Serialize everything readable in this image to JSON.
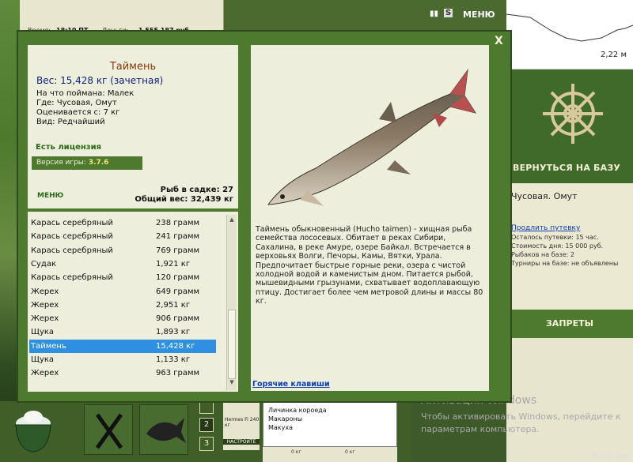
{
  "topbar": {
    "time_label": "Время:",
    "time_value": "18:10 ПТ",
    "money_label": "Деньги:",
    "money_value": "1 555 187 руб",
    "menu_label": "МЕНЮ"
  },
  "depth_chart": {
    "depth": "2,22 м"
  },
  "right_sidebar": {
    "return_label": "ВЕРНУТЬСЯ НА БАЗУ",
    "location": "Чусовая. Омут",
    "extend_link": "Продлить путевку",
    "lines": [
      "Осталось путевки: 15 час.",
      "Стоимость дня: 15 000 руб.",
      "Рыбаков на базе: 2",
      "Турниры на базе: не объявлены"
    ],
    "bans_label": "ЗАПРЕТЫ"
  },
  "fish_info": {
    "name": "Таймень",
    "weight": "Вес: 15,428 кг (зачетная)",
    "caught_on": "На что поймана: Малек",
    "where": "Где: Чусовая, Омут",
    "valued": "Оценивается с: 7 кг",
    "kind": "Вид: Редчайший",
    "license": "Есть лицензия",
    "version_label": "Версия игры:",
    "version_value": "3.7.6",
    "menu": "МЕНЮ",
    "keep_count": "Рыб в садке: 27",
    "keep_weight": "Общий вес: 32,439 кг"
  },
  "catch_list": [
    {
      "name": "Карась серебряный",
      "weight": "238 грамм"
    },
    {
      "name": "Карась серебряный",
      "weight": "241 грамм"
    },
    {
      "name": "Карась серебряный",
      "weight": "769 грамм"
    },
    {
      "name": "Судак",
      "weight": "1,921 кг"
    },
    {
      "name": "Карась серебряный",
      "weight": "120 грамм"
    },
    {
      "name": "Жерех",
      "weight": "649 грамм"
    },
    {
      "name": "Жерех",
      "weight": "2,951 кг"
    },
    {
      "name": "Жерех",
      "weight": "906 грамм"
    },
    {
      "name": "Щука",
      "weight": "1,893 кг"
    },
    {
      "name": "Таймень",
      "weight": "15,428 кг",
      "selected": true
    },
    {
      "name": "Щука",
      "weight": "1,133 кг"
    },
    {
      "name": "Жерех",
      "weight": "963 грамм"
    }
  ],
  "description": "Таймень обыкновенный (Hucho taimen) - хищная рыба семейства лососевых. Обитает в реках Сибири, Сахалина, в реке Амуре, озере Байкал. Встречается в верховьях Волги, Печоры, Камы, Вятки, Урала. Предпочитает быстрые горные реки, озера с чистой холодной водой и каменистым дном. Питается рыбой, мышевидными грызунами, схватывает водоплавающую птицу. Достигает более чем метровой длины и массы 80 кг.",
  "hotkeys": "Горячие клавиши",
  "close": "X",
  "bottom": {
    "slots": [
      "2",
      "3"
    ],
    "rod_text": "Hermes Fi 240 кг",
    "rod_button": "НАСТРОЙТЕ",
    "baits": [
      "Личинка короеда",
      "Макароны",
      "Макуха"
    ],
    "bait_sub": [
      "0 кг",
      "0 кг"
    ]
  },
  "windows": {
    "title": "Активация Windows",
    "line1": "Чтобы активировать Windows, перейдите к",
    "line2": "параметрам компьютера.",
    "build": "Build 960"
  }
}
